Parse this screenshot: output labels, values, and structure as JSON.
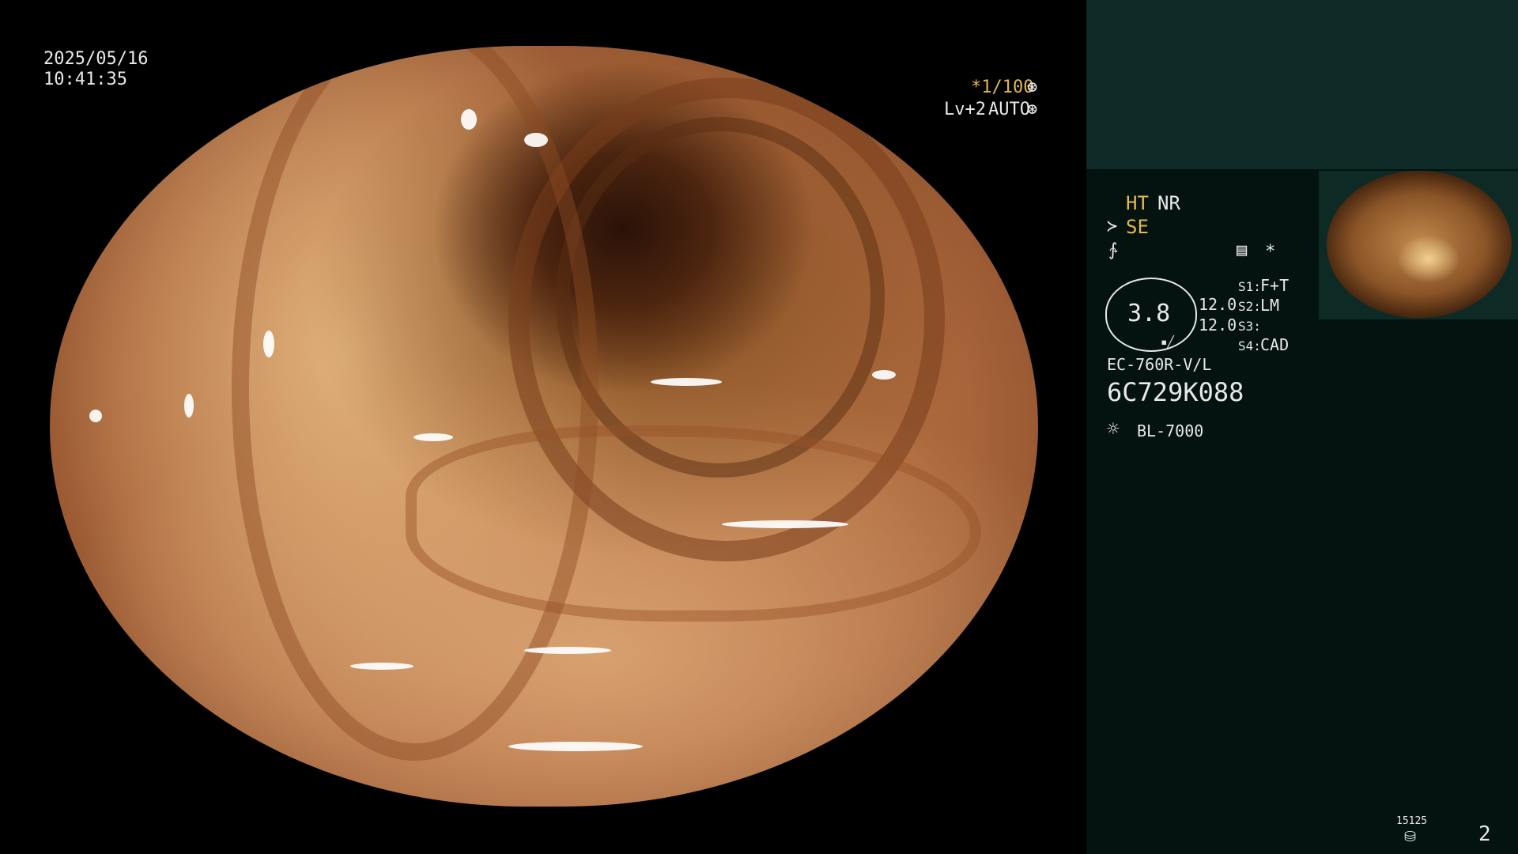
{
  "overlay": {
    "date": "2025/05/16",
    "time": "10:41:35",
    "shutter": "*1/100",
    "level": "Lv+2",
    "mode": "AUTO"
  },
  "panel": {
    "ht": "HT",
    "nr": "NR",
    "se": "SE",
    "gauge_value": "3.8",
    "val1": "12.0",
    "val2": "12.0",
    "s1_key": "S1:",
    "s1_val": "F+T",
    "s2_key": "S2:",
    "s2_val": "LM",
    "s3_key": "S3:",
    "s3_val": "",
    "s4_key": "S4:",
    "s4_val": "CAD",
    "scope_model": "EC-760R-V/L",
    "serial": "6C729K088",
    "light_source": "BL-7000",
    "counter_top": "15125",
    "page_number": "2"
  },
  "icons": {
    "shutter": "aperture-icon",
    "auto": "aperture-icon",
    "se": "enhancement-icon",
    "squiggle": "waveform-icon",
    "monitor": "image-adjust-icon",
    "star": "asterisk-icon",
    "light": "sun-icon",
    "storage": "disk-icon"
  },
  "colors": {
    "accent": "#e6b84a",
    "panel_top": "#0d2a26",
    "panel_body": "#041210"
  }
}
